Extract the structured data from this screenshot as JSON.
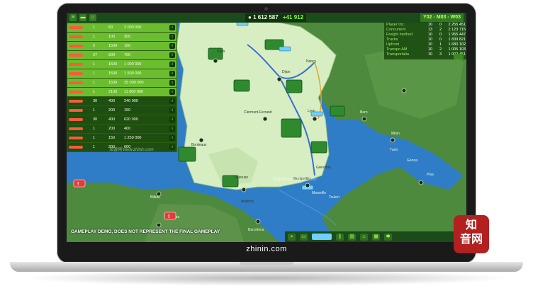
{
  "game": {
    "money": "1 612 587",
    "money_delta": "+41 912",
    "date": "Y02 - M03 - W03"
  },
  "fleet": {
    "rows": [
      {
        "a": "1",
        "b": "60",
        "c": "2 000 000",
        "style": "light"
      },
      {
        "a": "1",
        "b": "100",
        "c": "300",
        "style": "light"
      },
      {
        "a": "2",
        "b": "1500",
        "c": "100",
        "style": "light"
      },
      {
        "a": "27",
        "b": "500",
        "c": "700",
        "style": "light"
      },
      {
        "a": "1",
        "b": "1500",
        "c": "1 000 000",
        "style": "light"
      },
      {
        "a": "1",
        "b": "1500",
        "c": "1 500 000",
        "style": "light"
      },
      {
        "a": "1",
        "b": "1500",
        "c": "25 000 000",
        "style": "light"
      },
      {
        "a": "1",
        "b": "2100",
        "c": "11 000 000",
        "style": "light"
      },
      {
        "a": "30",
        "b": "400",
        "c": "240 000",
        "style": "dark"
      },
      {
        "a": "1",
        "b": "200",
        "c": "150",
        "style": "dark"
      },
      {
        "a": "30",
        "b": "400",
        "c": "620 000",
        "style": "dark"
      },
      {
        "a": "1",
        "b": "200",
        "c": "400",
        "style": "dark"
      },
      {
        "a": "1",
        "b": "150",
        "c": "1 250 000",
        "style": "dark"
      },
      {
        "a": "1",
        "b": "200",
        "c": "600",
        "style": "dark"
      }
    ]
  },
  "stats": {
    "rows": [
      {
        "label": "Player Inc.",
        "a": "10",
        "b": "0",
        "big": "2 255 451"
      },
      {
        "label": "Concurrent",
        "a": "13",
        "b": "2",
        "big": "2 123 715"
      },
      {
        "label": "Freight method",
        "a": "10",
        "b": "0",
        "big": "1 955 447"
      },
      {
        "label": "Trucks",
        "a": "10",
        "b": "0",
        "big": "1 839 821"
      },
      {
        "label": "Upfront",
        "a": "10",
        "b": "1",
        "big": "1 680 102"
      },
      {
        "label": "Transpo AM",
        "a": "10",
        "b": "2",
        "big": "1 005 103"
      },
      {
        "label": "Transportalia",
        "a": "10",
        "b": "3",
        "big": "1 002 451"
      }
    ]
  },
  "map": {
    "cities": [
      "Paris",
      "Dijon",
      "Lyon",
      "Bordeaux",
      "Toulouse",
      "Marseille",
      "Bern",
      "Milan",
      "Turin",
      "Genoa",
      "Barcelona",
      "Bilbao",
      "Zaragoza",
      "Andorra",
      "Montpellier",
      "Clermont-Ferrand",
      "Pisa",
      "Grenoble",
      "Nancy",
      "Toulon"
    ]
  },
  "disclaimer": "GAMEPLAY DEMO, DOES NOT REPRESENT THE FINAL GAMEPLAY",
  "laptop": {
    "brand": "zhinin.com"
  },
  "watermark_text": "知音网 www.zhinin.com",
  "stamp_text": "知音网",
  "colors": {
    "ui_green": "#6bbd2f",
    "ui_dark": "#1b4b1b",
    "sea": "#2f7dc6",
    "france": "#d7eec3",
    "hills": "#4e8a3e"
  }
}
